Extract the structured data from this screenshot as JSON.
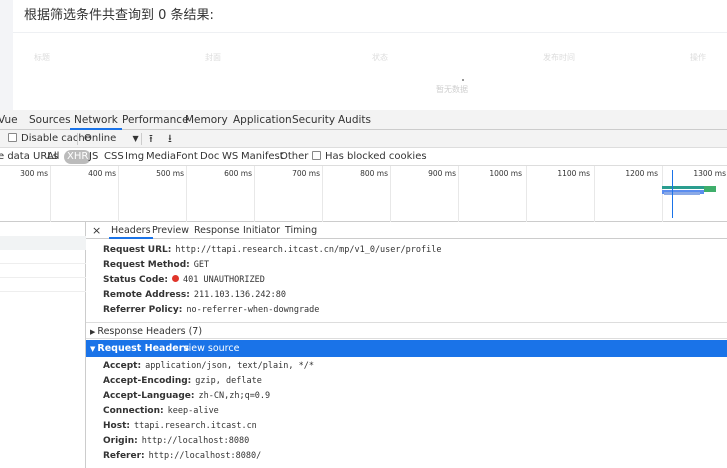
{
  "page": {
    "result_text": "根据筛选条件共查询到 0 条结果:",
    "ghost_labels": [
      "标题",
      "封面",
      "状态",
      "发布时间",
      "操作"
    ],
    "ghost_empty": "暂无数据"
  },
  "devtools": {
    "tabs": [
      "Vue",
      "Sources",
      "Network",
      "Performance",
      "Memory",
      "Application",
      "Security",
      "Audits"
    ],
    "active_tab": "Network",
    "toolbar": {
      "disable_cache": "Disable cache",
      "throttle": "Online",
      "dropdown_icon": "▼",
      "upload_icon": "⭱",
      "download_icon": "⭳"
    },
    "filters": [
      "e data URLs",
      "All",
      "XHR",
      "JS",
      "CSS",
      "Img",
      "Media",
      "Font",
      "Doc",
      "WS",
      "Manifest",
      "Other"
    ],
    "active_filter": "XHR",
    "has_blocked": "Has blocked cookies",
    "timeline_ticks": [
      "300 ms",
      "400 ms",
      "500 ms",
      "600 ms",
      "700 ms",
      "800 ms",
      "900 ms",
      "1000 ms",
      "1100 ms",
      "1200 ms",
      "1300 ms"
    ],
    "detail_tabs": [
      "Headers",
      "Preview",
      "Response",
      "Initiator",
      "Timing"
    ],
    "active_detail_tab": "Headers",
    "close_icon": "×",
    "general": [
      {
        "k": "Request URL:",
        "v": "http://ttapi.research.itcast.cn/mp/v1_0/user/profile"
      },
      {
        "k": "Request Method:",
        "v": "GET"
      },
      {
        "k": "Status Code:",
        "v": "401 UNAUTHORIZED"
      },
      {
        "k": "Remote Address:",
        "v": "211.103.136.242:80"
      },
      {
        "k": "Referrer Policy:",
        "v": "no-referrer-when-downgrade"
      }
    ],
    "response_headers_label": "Response Headers (7)",
    "request_headers_label": "Request Headers",
    "view_source": "view source",
    "request_headers": [
      {
        "k": "Accept:",
        "v": "application/json, text/plain, */*"
      },
      {
        "k": "Accept-Encoding:",
        "v": "gzip, deflate"
      },
      {
        "k": "Accept-Language:",
        "v": "zh-CN,zh;q=0.9"
      },
      {
        "k": "Connection:",
        "v": "keep-alive"
      },
      {
        "k": "Host:",
        "v": "ttapi.research.itcast.cn"
      },
      {
        "k": "Origin:",
        "v": "http://localhost:8080"
      },
      {
        "k": "Referer:",
        "v": "http://localhost:8080/"
      }
    ],
    "colors": {
      "accent": "#1a73e8",
      "status_error": "#e0352b"
    }
  }
}
